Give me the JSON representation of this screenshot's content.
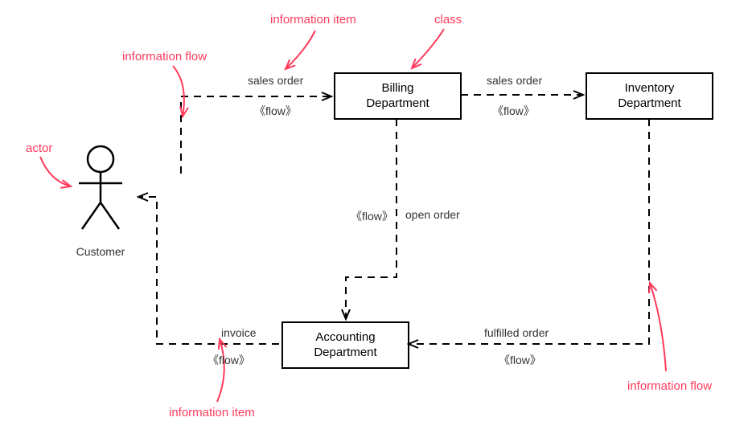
{
  "actor": {
    "name": "Customer"
  },
  "classes": {
    "billing": {
      "label": "Billing\nDepartment"
    },
    "inventory": {
      "label": "Inventory\nDepartment"
    },
    "accounting": {
      "label": "Accounting\nDepartment"
    }
  },
  "flows": {
    "customer_to_billing": {
      "item": "sales order",
      "stereotype": "《flow》"
    },
    "billing_to_inventory": {
      "item": "sales order",
      "stereotype": "《flow》"
    },
    "billing_to_accounting": {
      "item": "open order",
      "stereotype": "《flow》"
    },
    "inventory_to_accounting": {
      "item": "fulfilled order",
      "stereotype": "《flow》"
    },
    "accounting_to_customer": {
      "item": "invoice",
      "stereotype": "《flow》"
    }
  },
  "annotations": {
    "actor": "actor",
    "information_flow_left": "information flow",
    "information_flow_right": "information flow",
    "information_item_top": "information item",
    "information_item_bottom": "information item",
    "class": "class"
  }
}
